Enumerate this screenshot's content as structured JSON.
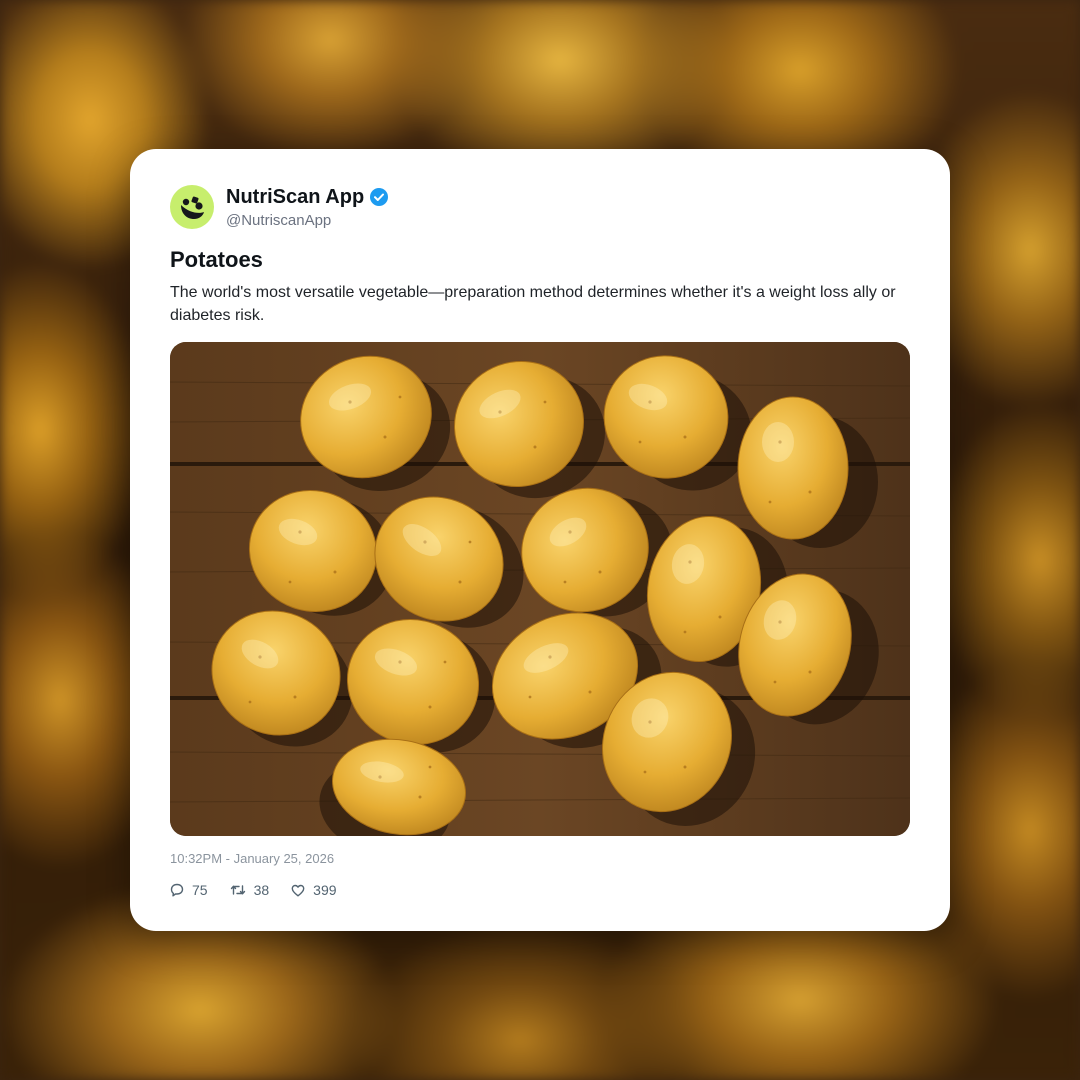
{
  "post": {
    "author": {
      "display_name": "NutriScan App",
      "handle": "@NutriscanApp",
      "verified": true,
      "avatar_color": "#c7ee6d",
      "verified_color": "#1d9bf0"
    },
    "title": "Potatoes",
    "body": "The world's most versatile vegetable—preparation method determines whether it's a weight loss ally or diabetes risk.",
    "image_icon": "potatoes-photo",
    "timestamp": "10:32PM - January 25, 2026",
    "stats": {
      "replies": "75",
      "retweets": "38",
      "likes": "399"
    }
  }
}
